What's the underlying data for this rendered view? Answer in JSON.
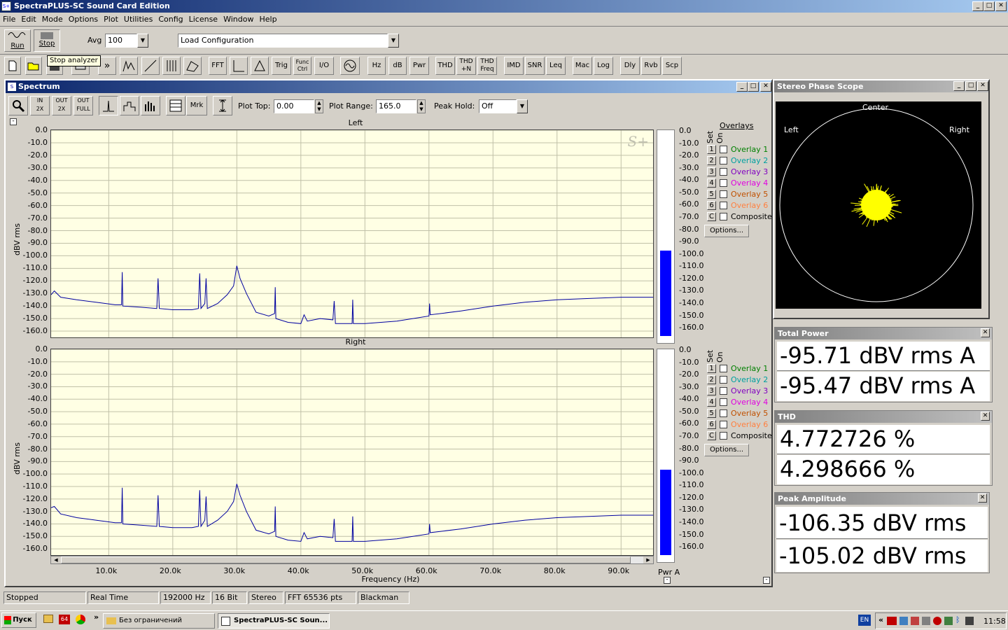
{
  "window": {
    "title": "SpectraPLUS-SC Sound Card Edition",
    "min": "_",
    "max": "□",
    "close": "✕"
  },
  "menu": [
    "File",
    "Edit",
    "Mode",
    "Options",
    "Plot",
    "Utilities",
    "Config",
    "License",
    "Window",
    "Help"
  ],
  "toolbar1": {
    "run": "Run",
    "stop": "Stop",
    "avg_label": "Avg",
    "avg_value": "100",
    "config_value": "Load Configuration",
    "tooltip": "Stop analyzer"
  },
  "toolbar2": [
    "FFT",
    "",
    "",
    "Trig",
    "Func Ctrl",
    "I/O",
    "",
    "Hz",
    "dB",
    "Pwr",
    "THD",
    "THD +N",
    "THD Freq",
    "IMD",
    "SNR",
    "Leq",
    "Mac",
    "Log",
    "Dly",
    "Rvb",
    "Scp"
  ],
  "spectrum": {
    "title": "Spectrum",
    "plot_top_label": "Plot Top:",
    "plot_top_value": "0.00",
    "plot_range_label": "Plot Range:",
    "plot_range_value": "165.0",
    "peak_hold_label": "Peak Hold:",
    "peak_hold_value": "Off",
    "mrk": "Mrk",
    "left_label": "Left",
    "right_label": "Right",
    "ylabel": "dBV rms",
    "xlabel": "Frequency (Hz)",
    "logo": "S+",
    "pwr_label": "Pwr A",
    "overlays_title": "Overlays",
    "set_label": "Set",
    "on_label": "On",
    "overlays": [
      {
        "num": "1",
        "name": "Overlay 1",
        "color": "#008000"
      },
      {
        "num": "2",
        "name": "Overlay 2",
        "color": "#00a0a0"
      },
      {
        "num": "3",
        "name": "Overlay 3",
        "color": "#8000c0"
      },
      {
        "num": "4",
        "name": "Overlay 4",
        "color": "#e000e0"
      },
      {
        "num": "5",
        "name": "Overlay 5",
        "color": "#c05000"
      },
      {
        "num": "6",
        "name": "Overlay 6",
        "color": "#ff8040"
      },
      {
        "num": "C",
        "name": "Composite",
        "color": "#000000"
      }
    ],
    "options_btn": "Options..."
  },
  "chart_data": [
    {
      "type": "line",
      "title": "Left",
      "xlabel": "Frequency (Hz)",
      "ylabel": "dBV rms",
      "yticks": [
        "0.0",
        "-10.0",
        "-20.0",
        "-30.0",
        "-40.0",
        "-50.0",
        "-60.0",
        "-70.0",
        "-80.0",
        "-90.0",
        "-100.0",
        "-110.0",
        "-120.0",
        "-130.0",
        "-140.0",
        "-150.0",
        "-160.0"
      ],
      "xticks": [
        "10.0k",
        "20.0k",
        "30.0k",
        "40.0k",
        "50.0k",
        "60.0k",
        "70.0k",
        "80.0k",
        "90.0k"
      ],
      "xlim": [
        1000,
        95000
      ],
      "ylim": [
        -165,
        0
      ],
      "grid": true,
      "meter_value": -95.71,
      "series": [
        {
          "color": "#0000a0",
          "points": [
            [
              1000,
              -131
            ],
            [
              1500,
              -128
            ],
            [
              2500,
              -133
            ],
            [
              5000,
              -135
            ],
            [
              8000,
              -137
            ],
            [
              11000,
              -139
            ],
            [
              12000,
              -139
            ],
            [
              12100,
              -113
            ],
            [
              12200,
              -140
            ],
            [
              15000,
              -141
            ],
            [
              17500,
              -142
            ],
            [
              17700,
              -118
            ],
            [
              17900,
              -142
            ],
            [
              20000,
              -143
            ],
            [
              23000,
              -143
            ],
            [
              24000,
              -142
            ],
            [
              24200,
              -114
            ],
            [
              24400,
              -142
            ],
            [
              25000,
              -138
            ],
            [
              25200,
              -118
            ],
            [
              25400,
              -142
            ],
            [
              27000,
              -138
            ],
            [
              28500,
              -131
            ],
            [
              29500,
              -124
            ],
            [
              30000,
              -108
            ],
            [
              30500,
              -118
            ],
            [
              31500,
              -130
            ],
            [
              33000,
              -145
            ],
            [
              35000,
              -148
            ],
            [
              35900,
              -146
            ],
            [
              36000,
              -125
            ],
            [
              36100,
              -150
            ],
            [
              38000,
              -153
            ],
            [
              40000,
              -154
            ],
            [
              40500,
              -147
            ],
            [
              41000,
              -152
            ],
            [
              43000,
              -150
            ],
            [
              45000,
              -151
            ],
            [
              45200,
              -136
            ],
            [
              45400,
              -154
            ],
            [
              48000,
              -154
            ],
            [
              48100,
              -135
            ],
            [
              48200,
              -154
            ],
            [
              50000,
              -154
            ],
            [
              55000,
              -152
            ],
            [
              60000,
              -148
            ],
            [
              60100,
              -138
            ],
            [
              60200,
              -147
            ],
            [
              65000,
              -144
            ],
            [
              70000,
              -140
            ],
            [
              75000,
              -137
            ],
            [
              80000,
              -135
            ],
            [
              85000,
              -134
            ],
            [
              90000,
              -133
            ],
            [
              95000,
              -133
            ]
          ]
        }
      ]
    },
    {
      "type": "line",
      "title": "Right",
      "xlabel": "Frequency (Hz)",
      "ylabel": "dBV rms",
      "yticks": [
        "0.0",
        "-10.0",
        "-20.0",
        "-30.0",
        "-40.0",
        "-50.0",
        "-60.0",
        "-70.0",
        "-80.0",
        "-90.0",
        "-100.0",
        "-110.0",
        "-120.0",
        "-130.0",
        "-140.0",
        "-150.0",
        "-160.0"
      ],
      "xticks": [
        "10.0k",
        "20.0k",
        "30.0k",
        "40.0k",
        "50.0k",
        "60.0k",
        "70.0k",
        "80.0k",
        "90.0k"
      ],
      "xlim": [
        1000,
        95000
      ],
      "ylim": [
        -165,
        0
      ],
      "grid": true,
      "meter_value": -95.47,
      "series": [
        {
          "color": "#0000a0",
          "points": [
            [
              1000,
              -127
            ],
            [
              1500,
              -126
            ],
            [
              2500,
              -132
            ],
            [
              5000,
              -135
            ],
            [
              8000,
              -137
            ],
            [
              11000,
              -139
            ],
            [
              12000,
              -139
            ],
            [
              12100,
              -111
            ],
            [
              12200,
              -140
            ],
            [
              15000,
              -141
            ],
            [
              17500,
              -142
            ],
            [
              17700,
              -117
            ],
            [
              17900,
              -142
            ],
            [
              20000,
              -143
            ],
            [
              23000,
              -143
            ],
            [
              24000,
              -142
            ],
            [
              24200,
              -113
            ],
            [
              24400,
              -142
            ],
            [
              25000,
              -137
            ],
            [
              25200,
              -118
            ],
            [
              25400,
              -142
            ],
            [
              27000,
              -137
            ],
            [
              28500,
              -130
            ],
            [
              29500,
              -122
            ],
            [
              30000,
              -108
            ],
            [
              30500,
              -117
            ],
            [
              31500,
              -130
            ],
            [
              33000,
              -145
            ],
            [
              35000,
              -148
            ],
            [
              35900,
              -146
            ],
            [
              36000,
              -126
            ],
            [
              36100,
              -150
            ],
            [
              38000,
              -153
            ],
            [
              40000,
              -154
            ],
            [
              40500,
              -147
            ],
            [
              41000,
              -152
            ],
            [
              43000,
              -150
            ],
            [
              45000,
              -151
            ],
            [
              45200,
              -136
            ],
            [
              45400,
              -154
            ],
            [
              48000,
              -154
            ],
            [
              48100,
              -134
            ],
            [
              48200,
              -154
            ],
            [
              50000,
              -154
            ],
            [
              55000,
              -152
            ],
            [
              60000,
              -148
            ],
            [
              60100,
              -140
            ],
            [
              60200,
              -147
            ],
            [
              65000,
              -144
            ],
            [
              70000,
              -140
            ],
            [
              75000,
              -137
            ],
            [
              80000,
              -135
            ],
            [
              85000,
              -134
            ],
            [
              90000,
              -133
            ],
            [
              95000,
              -133
            ]
          ]
        }
      ]
    }
  ],
  "meter_ticks": [
    "0.0",
    "-10.0",
    "-20.0",
    "-30.0",
    "-40.0",
    "-50.0",
    "-60.0",
    "-70.0",
    "-80.0",
    "-90.0",
    "-100.0",
    "-110.0",
    "-120.0",
    "-130.0",
    "-140.0",
    "-150.0",
    "-160.0"
  ],
  "phase_scope": {
    "title": "Stereo Phase Scope",
    "center": "Center",
    "left": "Left",
    "right": "Right"
  },
  "total_power": {
    "title": "Total Power",
    "v1": "-95.71 dBV rms A",
    "v2": "-95.47 dBV rms A"
  },
  "thd": {
    "title": "THD",
    "v1": "4.772726 %",
    "v2": "4.298666 %"
  },
  "peak": {
    "title": "Peak Amplitude",
    "v1": "-106.35 dBV rms",
    "v2": "-105.02 dBV rms"
  },
  "status": [
    "Stopped",
    "Real Time",
    "192000 Hz",
    "16 Bit",
    "Stereo",
    "FFT 65536 pts",
    "Blackman"
  ],
  "taskbar": {
    "start": "Пуск",
    "task1": "Без ограничений",
    "task2": "SpectraPLUS-SC Soun...",
    "lang": "EN",
    "clock": "11:58",
    "chev": "»"
  }
}
